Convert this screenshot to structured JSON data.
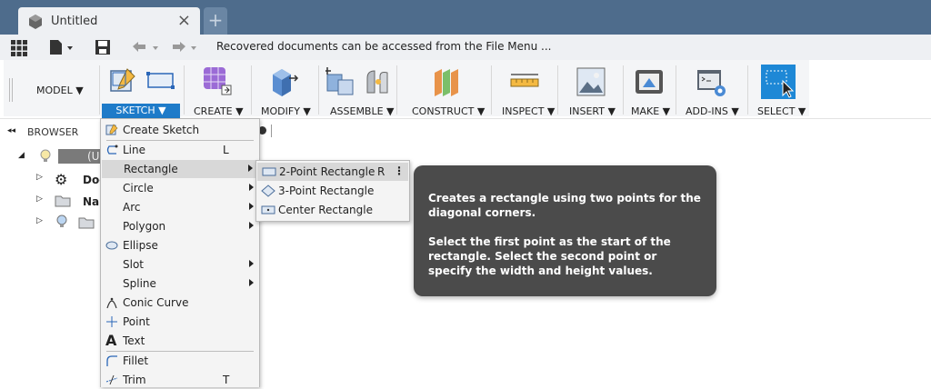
{
  "tab": {
    "title": "Untitled",
    "close": "×",
    "new_tab": "+"
  },
  "qat": {
    "message": "Recovered documents can be accessed from the File Menu ..."
  },
  "ribbon": {
    "workspace": "MODEL ▼",
    "groups": {
      "sketch": "SKETCH ▼",
      "create": "CREATE ▼",
      "modify": "MODIFY ▼",
      "assemble": "ASSEMBLE ▼",
      "construct": "CONSTRUCT ▼",
      "inspect": "INSPECT ▼",
      "insert": "INSERT ▼",
      "make": "MAKE ▼",
      "addins": "ADD-INS ▼",
      "select": "SELECT ▼"
    }
  },
  "browser": {
    "label": "BROWSER",
    "items": [
      "(U",
      "Doc",
      "Nar"
    ]
  },
  "sketch_menu": {
    "items": [
      {
        "label": "Create Sketch",
        "key": ""
      },
      {
        "label": "Line",
        "key": "L"
      },
      {
        "label": "Rectangle",
        "key": ""
      },
      {
        "label": "Circle",
        "key": ""
      },
      {
        "label": "Arc",
        "key": ""
      },
      {
        "label": "Polygon",
        "key": ""
      },
      {
        "label": "Ellipse",
        "key": ""
      },
      {
        "label": "Slot",
        "key": ""
      },
      {
        "label": "Spline",
        "key": ""
      },
      {
        "label": "Conic Curve",
        "key": ""
      },
      {
        "label": "Point",
        "key": ""
      },
      {
        "label": "Text",
        "key": ""
      },
      {
        "label": "Fillet",
        "key": ""
      },
      {
        "label": "Trim",
        "key": "T"
      }
    ]
  },
  "rect_submenu": {
    "items": [
      {
        "label": "2-Point Rectangle",
        "key": "R"
      },
      {
        "label": "3-Point Rectangle",
        "key": ""
      },
      {
        "label": "Center Rectangle",
        "key": ""
      }
    ]
  },
  "tooltip": {
    "para1": "Creates a rectangle using two points for the diagonal corners.",
    "para2": "Select the first point as the start of the rectangle. Select the second point or specify the width and height values."
  },
  "colors": {
    "titlebar": "#4e6c8c",
    "accent": "#1e7bc9",
    "tooltip_bg": "#4b4b4b"
  }
}
